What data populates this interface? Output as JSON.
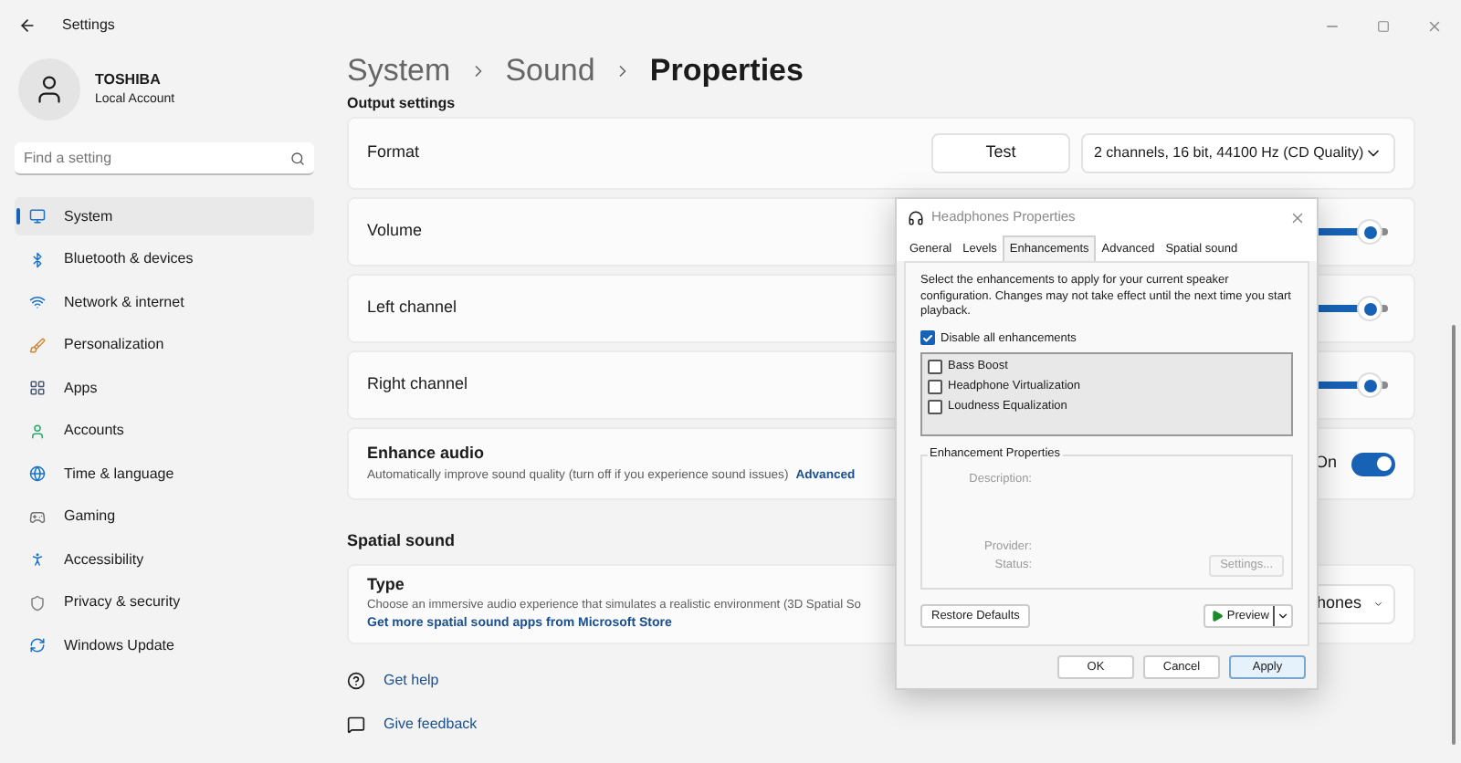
{
  "window": {
    "title": "Settings"
  },
  "account": {
    "name": "TOSHIBA",
    "type": "Local Account"
  },
  "search": {
    "placeholder": "Find a setting"
  },
  "sidebar": {
    "items": [
      {
        "label": "System",
        "selected": true
      },
      {
        "label": "Bluetooth & devices",
        "selected": false
      },
      {
        "label": "Network & internet",
        "selected": false
      },
      {
        "label": "Personalization",
        "selected": false
      },
      {
        "label": "Apps",
        "selected": false
      },
      {
        "label": "Accounts",
        "selected": false
      },
      {
        "label": "Time & language",
        "selected": false
      },
      {
        "label": "Gaming",
        "selected": false
      },
      {
        "label": "Accessibility",
        "selected": false
      },
      {
        "label": "Privacy & security",
        "selected": false
      },
      {
        "label": "Windows Update",
        "selected": false
      }
    ]
  },
  "breadcrumb": [
    "System",
    "Sound",
    "Properties"
  ],
  "output_settings": {
    "heading": "Output settings",
    "rows": [
      {
        "kind": "format",
        "label": "Format",
        "button": "Test",
        "value": "2 channels, 16 bit, 44100 Hz (CD Quality)"
      },
      {
        "kind": "slider",
        "label": "Volume",
        "level": 0.95
      },
      {
        "kind": "slider",
        "label": "Left channel",
        "level": 0.95
      },
      {
        "kind": "slider",
        "label": "Right channel",
        "level": 0.95
      },
      {
        "kind": "toggle",
        "label": "Enhance audio",
        "description": "Automatically improve sound quality (turn off if you experience sound issues)",
        "link": "Advanced",
        "state_label": "On",
        "on": true
      }
    ]
  },
  "spatial_sound": {
    "heading": "Spatial sound",
    "label": "Type",
    "description": "Choose an immersive audio experience that simulates a realistic environment (3D Spatial So",
    "link": "Get more spatial sound apps from Microsoft Store",
    "value": "hones"
  },
  "help_links": [
    "Get help",
    "Give feedback"
  ],
  "dialog": {
    "title": "Headphones Properties",
    "tabs": [
      {
        "label": "General",
        "selected": false
      },
      {
        "label": "Levels",
        "selected": false
      },
      {
        "label": "Enhancements",
        "selected": true
      },
      {
        "label": "Advanced",
        "selected": false
      },
      {
        "label": "Spatial sound",
        "selected": false
      }
    ],
    "intro": "Select the enhancements to apply for your current speaker configuration. Changes may not take effect until the next time you start playback.",
    "disable_all": {
      "label": "Disable all enhancements",
      "checked": true
    },
    "enhancements": [
      {
        "label": "Bass Boost",
        "checked": false
      },
      {
        "label": "Headphone Virtualization",
        "checked": false
      },
      {
        "label": "Loudness Equalization",
        "checked": false
      }
    ],
    "properties": {
      "heading": "Enhancement Properties",
      "fields": [
        "Description:",
        "Provider:",
        "Status:"
      ],
      "settings_button": "Settings...",
      "settings_disabled": true
    },
    "restore_button": "Restore Defaults",
    "preview_button": "Preview",
    "buttons": [
      {
        "label": "OK",
        "selected": false
      },
      {
        "label": "Cancel",
        "selected": false
      },
      {
        "label": "Apply",
        "selected": true
      }
    ]
  }
}
